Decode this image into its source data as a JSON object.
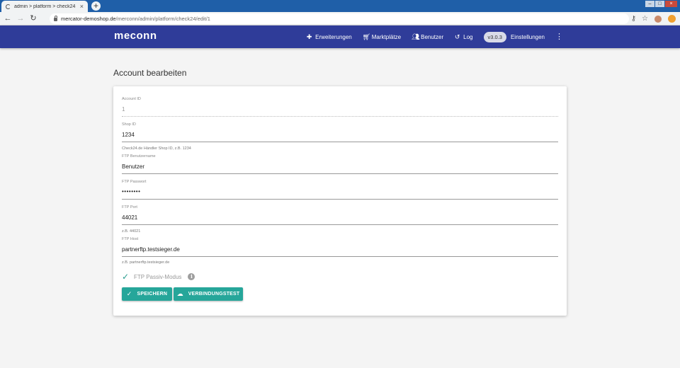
{
  "browser": {
    "tab_title": "admin > platform > check24",
    "tab_close": "×",
    "new_tab": "+",
    "url_host": "mercator-demoshop.de",
    "url_path": "/merconn/admin/platform/check24/edit/1",
    "back": "←",
    "forward": "→",
    "reload": "↻"
  },
  "appbar": {
    "logo": "meconn",
    "nav": [
      {
        "label": "Erweiterungen",
        "icon": "puzzle-icon"
      },
      {
        "label": "Marktplätze",
        "icon": "cart-icon"
      },
      {
        "label": "Benutzer",
        "icon": "people-icon"
      },
      {
        "label": "Log",
        "icon": "history-icon"
      }
    ],
    "version": "v3.0.3",
    "settings": "Einstellungen"
  },
  "page": {
    "title": "Account bearbeiten"
  },
  "form": {
    "account_id": {
      "label": "Account ID",
      "value": "1"
    },
    "shop_id": {
      "label": "Shop ID",
      "value": "1234",
      "hint": "Check24.de Händler Shop ID, z.B. 1234"
    },
    "ftp_user": {
      "label": "FTP Benutzername",
      "value": "Benutzer"
    },
    "ftp_password": {
      "label": "FTP Passwort",
      "value": "••••••••"
    },
    "ftp_port": {
      "label": "FTP Port",
      "value": "44021",
      "hint": "z.B. 44021"
    },
    "ftp_host": {
      "label": "FTP Host",
      "value": "partnerftp.testsieger.de",
      "hint": "z.B. partnerftp.testsieger.de"
    },
    "passive_mode": {
      "label": "FTP Passiv-Modus",
      "checked": true
    },
    "save_label": "SPEICHERN",
    "test_label": "VERBINDUNGSTEST"
  },
  "colors": {
    "appbar": "#2f3c99",
    "accent": "#26a69a",
    "chrome": "#1f5fa8"
  }
}
